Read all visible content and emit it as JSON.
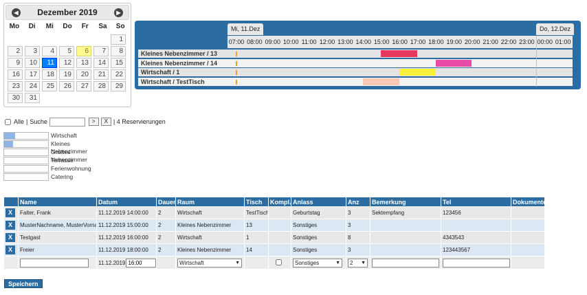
{
  "calendar": {
    "month_title": "Dezember 2019",
    "prev_icon": "◀",
    "next_icon": "▶",
    "weekdays": [
      "Mo",
      "Di",
      "Mi",
      "Do",
      "Fr",
      "Sa",
      "So"
    ],
    "days": [
      "",
      "",
      "",
      "",
      "",
      "",
      "1",
      "2",
      "3",
      "4",
      "5",
      "6",
      "7",
      "8",
      "9",
      "10",
      "11",
      "12",
      "13",
      "14",
      "15",
      "16",
      "17",
      "18",
      "19",
      "20",
      "21",
      "22",
      "23",
      "24",
      "25",
      "26",
      "27",
      "28",
      "29",
      "30",
      "31",
      "",
      "",
      "",
      "",
      ""
    ],
    "selected_day": "11",
    "today_day": "6"
  },
  "timeline": {
    "day1_label": "Mi, 11.Dez",
    "day2_label": "Do, 12.Dez",
    "hours": [
      "07:00",
      "08:00",
      "09:00",
      "10:00",
      "11:00",
      "12:00",
      "13:00",
      "14:00",
      "15:00",
      "16:00",
      "17:00",
      "18:00",
      "19:00",
      "20:00",
      "21:00",
      "22:00",
      "23:00",
      "00:00",
      "01:00"
    ],
    "rooms": [
      {
        "name": "Kleines Nebenzimmer / 13",
        "start_hour": 15.0,
        "end_hour": 17.0,
        "color": "#e8385e"
      },
      {
        "name": "Kleines Nebenzimmer / 14",
        "start_hour": 18.0,
        "end_hour": 20.0,
        "color": "#e84aa8"
      },
      {
        "name": "Wirtschaft / 1",
        "start_hour": 16.0,
        "end_hour": 18.0,
        "color": "#f6f23a"
      },
      {
        "name": "Wirtschaft / TestTisch",
        "start_hour": 14.0,
        "end_hour": 16.0,
        "color": "#f8c8b4"
      }
    ]
  },
  "search": {
    "all_label": "Alle",
    "search_label": "Suche",
    "search_value": "",
    "go_label": ">",
    "clear_label": "X",
    "count_text": "| 4 Reservierungen"
  },
  "legend": [
    {
      "label": "Wirtschaft",
      "fill": 0.25
    },
    {
      "label": "Kleines Nebenzimmer",
      "fill": 0.2
    },
    {
      "label": "Großes Nebenzimmer",
      "fill": 0
    },
    {
      "label": "Terrasse",
      "fill": 0
    },
    {
      "label": "Ferienwohnung",
      "fill": 0
    },
    {
      "label": "Catering",
      "fill": 0
    }
  ],
  "table": {
    "headers": [
      "",
      "Name",
      "Datum",
      "Dauer",
      "Raum",
      "Tisch",
      "Kompl.",
      "Anlass",
      "Anz",
      "Bemerkung",
      "Tel",
      "Dokumente"
    ],
    "rows": [
      {
        "delete": "X",
        "name": "Falter, Frank",
        "datum": "11.12.2019 14:00:00",
        "dauer": "2",
        "raum": "Wirtschaft",
        "tisch": "TestTisch",
        "kompl": "",
        "anlass": "Geburtstag",
        "anz": "3",
        "bemerkung": "Sektempfang",
        "tel": "123456",
        "dokumente": ""
      },
      {
        "delete": "X",
        "name": "MusterNachname, MusterVornam",
        "datum": "11.12.2019 15:00:00",
        "dauer": "2",
        "raum": "Kleines Nebenzimmer",
        "tisch": "13",
        "kompl": "",
        "anlass": "Sonstiges",
        "anz": "3",
        "bemerkung": "",
        "tel": "",
        "dokumente": ""
      },
      {
        "delete": "X",
        "name": "Testgast",
        "datum": "11.12.2019 16:00:00",
        "dauer": "2",
        "raum": "Wirtschaft",
        "tisch": "1",
        "kompl": "",
        "anlass": "Sonstiges",
        "anz": "8",
        "bemerkung": "",
        "tel": "4343543",
        "dokumente": ""
      },
      {
        "delete": "X",
        "name": "Freier",
        "datum": "11.12.2019 18:00:00",
        "dauer": "2",
        "raum": "Kleines Nebenzimmer",
        "tisch": "14",
        "kompl": "",
        "anlass": "Sonstiges",
        "anz": "3",
        "bemerkung": "",
        "tel": "123443567",
        "dokumente": ""
      }
    ],
    "new_row": {
      "name": "",
      "date": "11.12.2019",
      "time": "16:00",
      "raum": "Wirtschaft",
      "anlass": "Sonstiges",
      "anz": "2",
      "bemerkung": "",
      "tel": "",
      "select_arrow": "▼"
    }
  },
  "save_label": "Speichern",
  "colors": {
    "accent": "#2b6ca3",
    "selected_day": "#007fff",
    "today": "#fffa90"
  }
}
